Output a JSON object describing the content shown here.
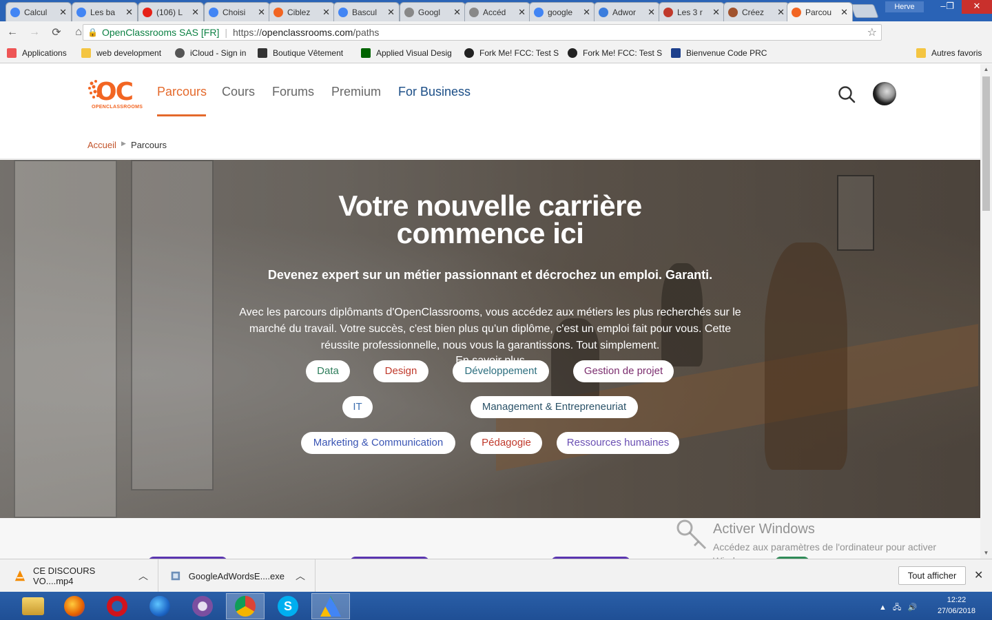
{
  "browser": {
    "tabs": [
      {
        "title": "Calcul",
        "icon": "google-icon",
        "color": "#4285f4"
      },
      {
        "title": "Les ba",
        "icon": "google-icon",
        "color": "#4285f4"
      },
      {
        "title": "(106) L",
        "icon": "youtube-icon",
        "color": "#e62117"
      },
      {
        "title": "Choisi",
        "icon": "google-icon",
        "color": "#4285f4"
      },
      {
        "title": "Ciblez",
        "icon": "openclassrooms-icon",
        "color": "#f26522"
      },
      {
        "title": "Bascul",
        "icon": "google-icon",
        "color": "#4285f4"
      },
      {
        "title": "Googl",
        "icon": "document-icon",
        "color": "#888888"
      },
      {
        "title": "Accéd",
        "icon": "document-icon",
        "color": "#888888"
      },
      {
        "title": "google",
        "icon": "google-icon",
        "color": "#4285f4"
      },
      {
        "title": "Adwor",
        "icon": "adwords-icon",
        "color": "#3b7ddd"
      },
      {
        "title": "Les 3 r",
        "icon": "edge-icon",
        "color": "#c0392b"
      },
      {
        "title": "Créez",
        "icon": "face-icon",
        "color": "#a0522d"
      },
      {
        "title": "Parcou",
        "icon": "openclassrooms-icon",
        "color": "#f26522",
        "active": true
      }
    ],
    "user": "Herve",
    "address": {
      "org": "OpenClassrooms SAS [FR]",
      "url_scheme": "https://",
      "url_host": "openclassrooms.com",
      "url_path": "/paths"
    },
    "bookmarks": [
      {
        "label": "Applications",
        "icon": "apps-grid-icon"
      },
      {
        "label": "web development",
        "icon": "folder-icon"
      },
      {
        "label": "iCloud - Sign in",
        "icon": "apple-icon"
      },
      {
        "label": "Boutique Vêtement",
        "icon": "camera-icon"
      },
      {
        "label": "Applied Visual Desig",
        "icon": "freecodecamp-icon"
      },
      {
        "label": "Fork Me! FCC: Test S",
        "icon": "codepen-icon"
      },
      {
        "label": "Fork Me! FCC: Test S",
        "icon": "codepen-icon"
      },
      {
        "label": "Bienvenue Code PRC",
        "icon": "prc-icon"
      },
      {
        "label": "Autres favoris",
        "icon": "folder-icon"
      }
    ]
  },
  "site": {
    "logo_text": "OPENCLASSROOMS",
    "nav": [
      "Parcours",
      "Cours",
      "Forums",
      "Premium",
      "For Business"
    ],
    "breadcrumb": {
      "home": "Accueil",
      "current": "Parcours"
    },
    "hero": {
      "title_line1": "Votre nouvelle carrière",
      "title_line2": "commence ici",
      "subtitle": "Devenez expert sur un métier passionnant et décrochez un emploi. Garanti.",
      "description": "Avec les parcours diplômants d'OpenClassrooms, vous accédez aux métiers les plus recherchés sur le marché du travail. Votre succès, c'est bien plus qu'un diplôme, c'est un emploi fait pour vous. Cette réussite professionnelle, nous vous la garantissons. Tout simplement.",
      "more_link": "En savoir plus"
    },
    "categories": [
      {
        "label": "Data",
        "color": "#2e7d5b"
      },
      {
        "label": "Design",
        "color": "#c0392b"
      },
      {
        "label": "Développement",
        "color": "#2b6e7e"
      },
      {
        "label": "Gestion de projet",
        "color": "#7b2d6e"
      },
      {
        "label": "IT",
        "color": "#3d6fb0"
      },
      {
        "label": "Management & Entrepreneuriat",
        "color": "#2a5268"
      },
      {
        "label": "Marketing & Communication",
        "color": "#3a55b4"
      },
      {
        "label": "Pédagogie",
        "color": "#c0392b"
      },
      {
        "label": "Ressources humaines",
        "color": "#6a4fb3"
      }
    ]
  },
  "watermark": {
    "title": "Activer Windows",
    "text": "Accédez aux paramètres de l'ordinateur pour activer Windows."
  },
  "downloads": [
    {
      "name": "CE DISCOURS VO....mp4",
      "icon": "vlc-icon"
    },
    {
      "name": "GoogleAdWordsE....exe",
      "icon": "installer-icon"
    }
  ],
  "downloads_show_all": "Tout afficher",
  "taskbar": {
    "apps": [
      "file-explorer-icon",
      "firefox-icon",
      "opera-icon",
      "firefox-dev-icon",
      "tor-icon",
      "chrome-icon",
      "skype-icon",
      "adwords-editor-icon"
    ],
    "time": "12:22",
    "date": "27/06/2018"
  }
}
